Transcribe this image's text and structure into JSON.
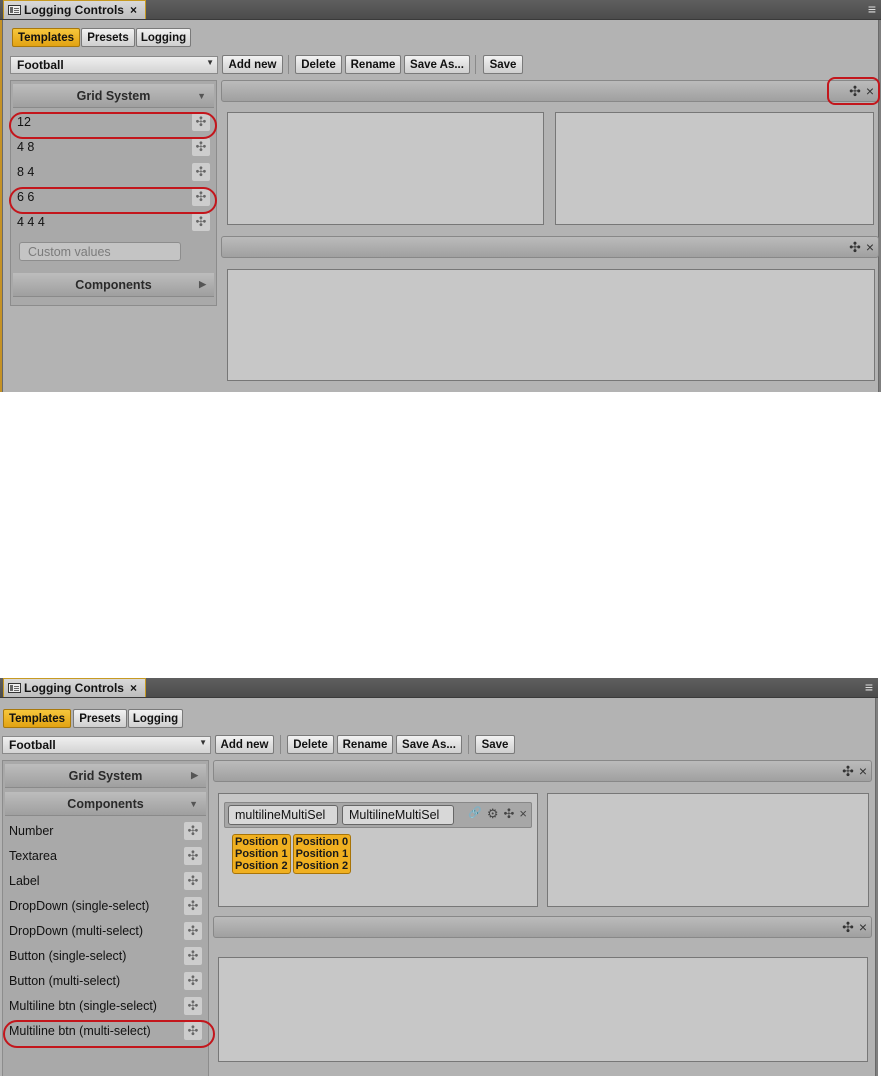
{
  "window": {
    "title": "Logging Controls",
    "close": "×",
    "menu_glyph": "≡"
  },
  "tabs": [
    "Templates",
    "Presets",
    "Logging"
  ],
  "template_select": {
    "value": "Football",
    "arrow": "▼"
  },
  "toolbar": {
    "add_new": "Add new",
    "delete": "Delete",
    "rename": "Rename",
    "save_as": "Save As...",
    "save": "Save"
  },
  "icons": {
    "move": "✣",
    "close": "×",
    "link": "🔗",
    "gear": "⚙",
    "expand": "▼",
    "collapse": "▶"
  },
  "colors": {
    "active_tab": "#e8ac1c",
    "highlight_ring": "#c3161c",
    "position_button": "#f0b020"
  },
  "top": {
    "grid_system_header": "Grid System",
    "grid_items": [
      "12",
      "4 8",
      "8 4",
      "6 6",
      "4 4 4"
    ],
    "custom_placeholder": "Custom values",
    "components_header": "Components"
  },
  "bottom": {
    "grid_system_header": "Grid System",
    "components_header": "Components",
    "component_items": [
      "Number",
      "Textarea",
      "Label",
      "DropDown (single-select)",
      "DropDown (multi-select)",
      "Button (single-select)",
      "Button (multi-select)",
      "Multiline btn (single-select)",
      "Multiline btn (multi-select)"
    ],
    "component_instance": {
      "id_value": "multilineMultiSel",
      "label_value": "MultilineMultiSel",
      "positions": [
        [
          "Position 0",
          "Position 1",
          "Position 2"
        ],
        [
          "Position 0",
          "Position 1",
          "Position 2"
        ]
      ]
    }
  }
}
